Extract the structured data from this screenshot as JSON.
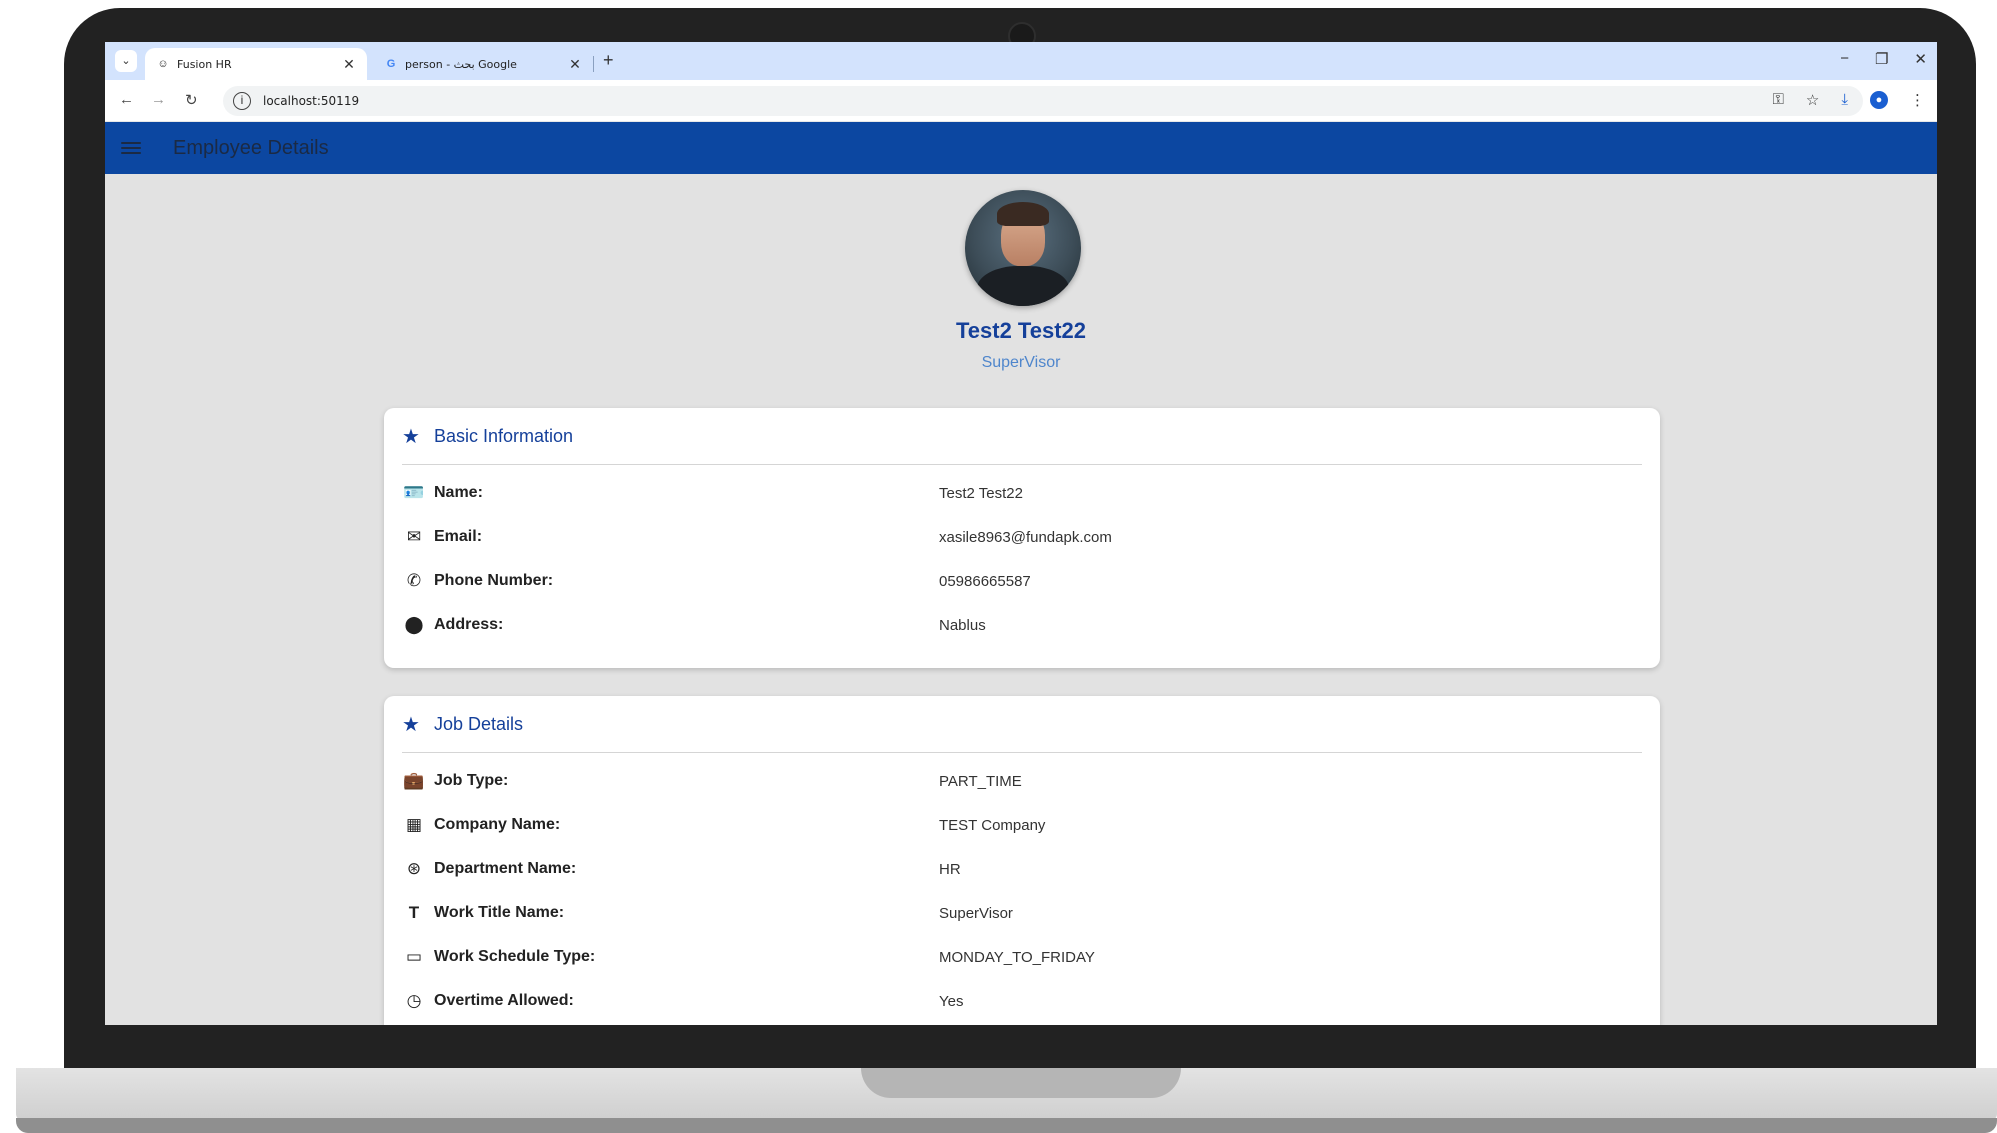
{
  "browser": {
    "tabs": [
      {
        "title": "Fusion HR",
        "active": true,
        "favicon": "fusion-hr-favicon"
      },
      {
        "title": "person - بحث Google",
        "active": false,
        "favicon": "google-favicon"
      }
    ],
    "url": "localhost:50119"
  },
  "app": {
    "title": "Employee Details"
  },
  "profile": {
    "name": "Test2 Test22",
    "role": "SuperVisor"
  },
  "basic_info": {
    "title": "Basic Information",
    "rows": [
      {
        "icon": "badge-icon",
        "label": "Name:",
        "value": "Test2 Test22"
      },
      {
        "icon": "email-icon",
        "label": "Email:",
        "value": "xasile8963@fundapk.com"
      },
      {
        "icon": "phone-icon",
        "label": "Phone Number:",
        "value": "05986665587"
      },
      {
        "icon": "location-icon",
        "label": "Address:",
        "value": "Nablus"
      }
    ]
  },
  "job_details": {
    "title": "Job Details",
    "rows": [
      {
        "icon": "briefcase-icon",
        "label": "Job Type:",
        "value": "PART_TIME"
      },
      {
        "icon": "building-icon",
        "label": "Company Name:",
        "value": "TEST Company"
      },
      {
        "icon": "department-icon",
        "label": "Department Name:",
        "value": "HR"
      },
      {
        "icon": "title-icon",
        "label": "Work Title Name:",
        "value": "SuperVisor"
      },
      {
        "icon": "calendar-icon",
        "label": "Work Schedule Type:",
        "value": "MONDAY_TO_FRIDAY"
      },
      {
        "icon": "clock-icon",
        "label": "Overtime Allowed:",
        "value": "Yes"
      }
    ]
  },
  "colors": {
    "appbar": "#0c47a1",
    "accent": "#15409a",
    "role": "#4f86cc"
  }
}
